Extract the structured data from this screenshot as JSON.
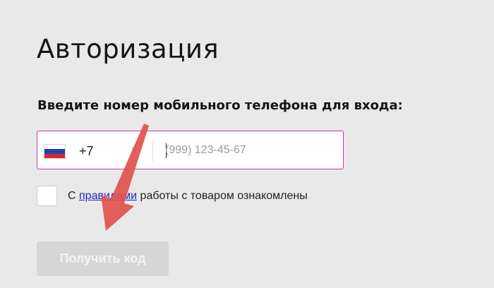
{
  "page": {
    "title": "Авторизация",
    "subtitle": "Введите номер мобильного телефона для входа:"
  },
  "phone": {
    "country_code": "+7",
    "country_flag": "russia-flag-icon",
    "placeholder": "(999) 123-45-67",
    "border_color": "#c23aa8"
  },
  "agreement": {
    "prefix": "С",
    "link_text": "правилами",
    "suffix": "работы с товаром ознакомлены",
    "checked": false
  },
  "submit": {
    "label": "Получить код",
    "enabled": false
  },
  "annotation": {
    "arrow_color": "#e0514d"
  }
}
